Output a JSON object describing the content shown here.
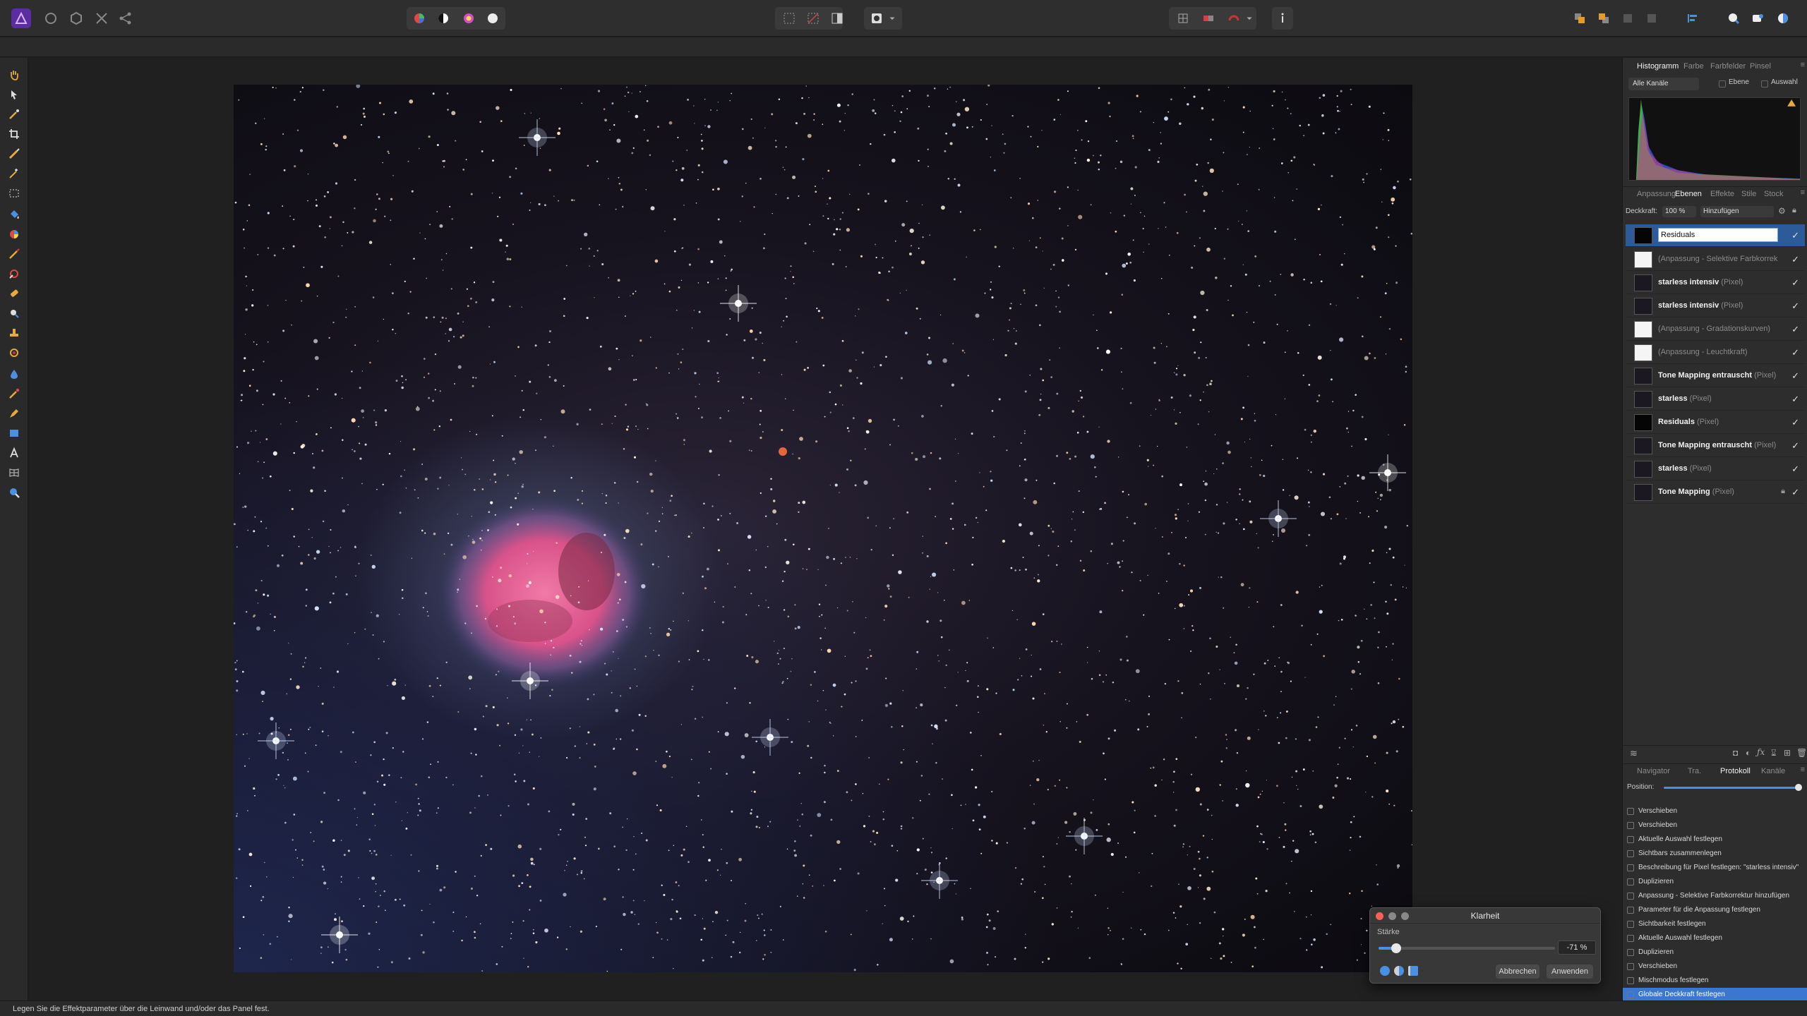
{
  "statusbar": {
    "text": "Legen Sie die Effektparameter über die Leinwand und/oder das Panel fest."
  },
  "dialog": {
    "title": "Klarheit",
    "strength_label": "Stärke",
    "strength_value": "-71 %",
    "strength_fraction": 0.1,
    "cancel": "Abbrechen",
    "apply": "Anwenden"
  },
  "histogram_panel": {
    "tabs": [
      "Histogramm",
      "Farbe",
      "Farbfelder",
      "Pinsel"
    ],
    "channel_select": "Alle Kanäle",
    "layer_label": "Ebene",
    "selection_label": "Auswahl"
  },
  "layers_panel": {
    "tabs": [
      "Anpassung",
      "Ebenen",
      "Effekte",
      "Stile",
      "Stock"
    ],
    "opacity_label": "Deckkraft:",
    "opacity_value": "100 %",
    "blend_mode": "Hinzufügen",
    "rename_value": "Residuals",
    "layers": [
      {
        "name": "(Anpassung - Selektive Farbkorrek",
        "type": "",
        "kind": "adj"
      },
      {
        "name": "starless intensiv",
        "type": "(Pixel)",
        "kind": "pixel"
      },
      {
        "name": "starless intensiv",
        "type": "(Pixel)",
        "kind": "pixel"
      },
      {
        "name": "(Anpassung - Gradationskurven)",
        "type": "",
        "kind": "adj"
      },
      {
        "name": "(Anpassung - Leuchtkraft)",
        "type": "",
        "kind": "adj"
      },
      {
        "name": "Tone Mapping entrauscht",
        "type": "(Pixel)",
        "kind": "pixel"
      },
      {
        "name": "starless",
        "type": "(Pixel)",
        "kind": "pixel"
      },
      {
        "name": "Residuals",
        "type": "(Pixel)",
        "kind": "dark"
      },
      {
        "name": "Tone Mapping entrauscht",
        "type": "(Pixel)",
        "kind": "pixel"
      },
      {
        "name": "starless",
        "type": "(Pixel)",
        "kind": "pixel"
      },
      {
        "name": "Tone Mapping",
        "type": "(Pixel)",
        "kind": "pixel"
      }
    ]
  },
  "history_panel": {
    "tabs": [
      "Navigator",
      "Tra.",
      "Protokoll",
      "Kanäle"
    ],
    "position_label": "Position:",
    "entries": [
      "Verschieben",
      "Verschieben",
      "Aktuelle Auswahl festlegen",
      "Sichtbars zusammenlegen",
      "Beschreibung für Pixel festlegen: \"starless intensiv\"",
      "Duplizieren",
      "Anpassung - Selektive Farbkorrektur hinzufügen",
      "Parameter für die Anpassung festlegen",
      "Sichtbarkeit festlegen",
      "Aktuelle Auswahl festlegen",
      "Duplizieren",
      "Verschieben",
      "Mischmodus festlegen",
      "Globale Deckkraft festlegen"
    ]
  },
  "colors": {
    "accent": "#3b77d0",
    "nebula": "#e2628f"
  }
}
